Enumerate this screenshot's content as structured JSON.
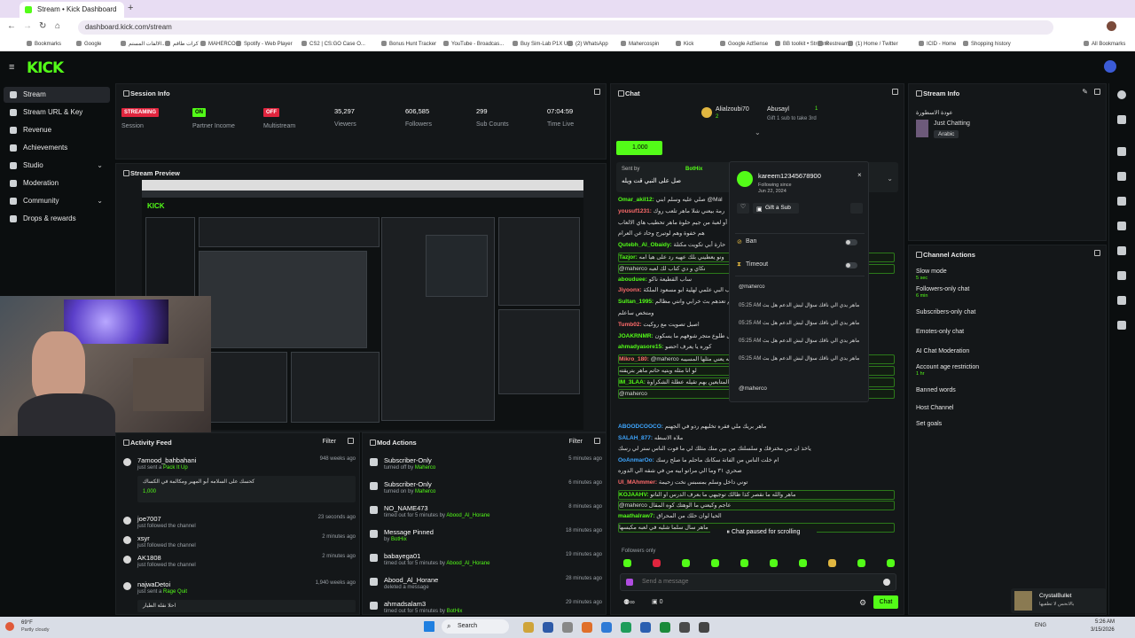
{
  "browser": {
    "tabs": [
      {
        "label": "Stream • Kick Dashboard"
      }
    ],
    "url": "dashboard.kick.com/stream",
    "bookmarks": [
      "Bookmarks",
      "Google",
      "الالفات المستم...",
      "كرات طاقم",
      "MAHERCO",
      "Spotify - Web Player",
      "CS2 | CS:GO Case O...",
      "Bonus Hunt Tracker",
      "YouTube - Broadcas...",
      "Buy Sim-Lab P1X Ul...",
      "(2) WhatsApp",
      "Mahercospin",
      "Kick",
      "Google AdSense",
      "BB toolkit • Streamr",
      "Restream",
      "(1) Home / Twitter",
      "ICID - Home",
      "Shopping history",
      "All Bookmarks"
    ]
  },
  "nav": {
    "items": [
      {
        "label": "Stream",
        "active": true
      },
      {
        "label": "Stream URL & Key"
      },
      {
        "label": "Revenue"
      },
      {
        "label": "Achievements"
      },
      {
        "label": "Studio",
        "chevron": true
      },
      {
        "label": "Moderation"
      },
      {
        "label": "Community",
        "chevron": true
      },
      {
        "label": "Drops & rewards"
      }
    ]
  },
  "session": {
    "title": "Session Info",
    "stats": [
      {
        "value": "STREAMING",
        "label": "Session",
        "badge": "red"
      },
      {
        "value": "ON",
        "label": "Partner Income",
        "badge": "green"
      },
      {
        "value": "OFF",
        "label": "Multistream",
        "badge": "red"
      },
      {
        "value": "35,297",
        "label": "Viewers"
      },
      {
        "value": "606,585",
        "label": "Followers"
      },
      {
        "value": "299",
        "label": "Sub Counts"
      },
      {
        "value": "07:04:59",
        "label": "Time Live"
      }
    ]
  },
  "preview": {
    "title": "Stream Preview"
  },
  "activity": {
    "title": "Activity Feed",
    "filter": "Filter",
    "items": [
      {
        "name": "7amood_bahbahani",
        "sub": "just sent a ",
        "extra": "Pack It Up",
        "time": "948 weeks ago",
        "note": "كحسك على السلامه أبو المهير ومكالمة في الكساك",
        "amount": "1,000"
      },
      {
        "name": "joe7007",
        "sub": "just followed the channel",
        "time": "23 seconds ago"
      },
      {
        "name": "xsyr",
        "sub": "just followed the channel",
        "time": "2 minutes ago"
      },
      {
        "name": "AK1808",
        "sub": "just followed the channel",
        "time": "2 minutes ago"
      },
      {
        "name": "najwaDetoi",
        "sub": "just sent a ",
        "extra": "Rage Quit",
        "time": "1,940 weeks ago",
        "note": "احلا نقلة الطيار"
      }
    ]
  },
  "mod": {
    "title": "Mod Actions",
    "filter": "Filter",
    "items": [
      {
        "name": "Subscriber-Only",
        "sub": "turned off by ",
        "who": "Maherco",
        "time": "5 minutes ago"
      },
      {
        "name": "Subscriber-Only",
        "sub": "turned on by ",
        "who": "Maherco",
        "time": "6 minutes ago"
      },
      {
        "name": "NO_NAME473",
        "sub": "timed out for 5 minutes by ",
        "who": "Abood_Al_Horane",
        "time": "8 minutes ago"
      },
      {
        "name": "Message Pinned",
        "sub": "by ",
        "who": "BotHix",
        "time": "18 minutes ago"
      },
      {
        "name": "babayega01",
        "sub": "timed out for 5 minutes by ",
        "who": "Abood_Al_Horane",
        "time": "19 minutes ago"
      },
      {
        "name": "Abood_Al_Horane",
        "sub": "deleted a message",
        "who": "",
        "time": "28 minutes ago"
      },
      {
        "name": "ahmadsalam3",
        "sub": "timed out for 5 minutes by ",
        "who": "BotHix",
        "time": "29 minutes ago"
      }
    ]
  },
  "chat": {
    "title": "Chat",
    "top": [
      {
        "name": "Alialzoubi70",
        "count": "2"
      },
      {
        "name": "Abusayl",
        "count": "1"
      }
    ],
    "gift_hint": "Gift 1 sub to take 3rd",
    "pill": "1,000",
    "pinned_by": "Sent by",
    "pinned_user": "BotHix",
    "pinned_text": "صل على النبي قت ويله",
    "lines": [
      {
        "user": "Omar_akil12:",
        "text": "صلي عليه وسلم ابني @Mal"
      },
      {
        "user": "yousuf1231:",
        "text": "رمة بيعني شلا ماهر تلعب روك",
        "c": "c3"
      },
      {
        "user": "",
        "text": "كتب أو لعبة من جيم حلوة ماهر تحطيب هاي الالعاب @Mahe"
      },
      {
        "user": "",
        "text": "هم خفوة وهم لوتيرج وحاد عن العرام"
      },
      {
        "user": "Qutebh_Al_Obaidy:",
        "text": "حارة أبي تكويت مكتلة"
      },
      {
        "user": "Tazjor:",
        "text": "ونو يعطيني بلك عهيه رد على هيا امه",
        "hl": true
      },
      {
        "user": "",
        "text": "@maherco نكاي و دي كتاب لك لعبه",
        "hl": true
      },
      {
        "user": "abouduee:",
        "text": "ساب القطيعة ناكو"
      },
      {
        "user": "Jiyoonx:",
        "text": "لعب البي علمي لهلية ابو مسعود الملكة",
        "c": "c3"
      },
      {
        "user": "Sultan_1995:",
        "text": "هو حرو زينهم تعدهم بث خرابي وانتي مظالم"
      },
      {
        "user": "",
        "text": "ومتخص ساعلم"
      },
      {
        "user": "Tumb02:",
        "text": "اصبل تصويت مع روكيت",
        "c": "c3"
      },
      {
        "user": "JOAKRNMR:",
        "text": "عمى طلوع متجر شوفهم ما يسكون"
      },
      {
        "user": "ahmadyasore15:",
        "text": "كوره يا يعرف احضو"
      },
      {
        "user": "Mikro_180:",
        "text": "@maherco نحن حته له يعني مثلها المسيبه",
        "c": "c3",
        "hl": true
      },
      {
        "user": "",
        "text": "لو انا مثله وبتيه حاتم ماهر بتريقته",
        "hl": true
      },
      {
        "user": "IM_3LAA:",
        "text": "المتابعين بهم تقيله عطلة الشكراوة",
        "hl": true
      },
      {
        "user": "",
        "text": "@maherco",
        "hl": true
      },
      {
        "user": "ABOODCOOCO:",
        "text": "ماهر بريك ملي فقره تخليهم ردو في الجهنم",
        "c": "c2"
      },
      {
        "user": "SALAH_877:",
        "text": "ملاه الاسطه",
        "c": "c2"
      },
      {
        "user": "",
        "text": "ياخذ ان من مخترقك و سلسلتك من بين منك مثلك لي ما فوت الناس ستر لي رسك"
      },
      {
        "user": "OoAnmarOo:",
        "text": "ام خلت الناس من الفاتة سكاتك ماحلم ما صلح رسك",
        "c": "c2"
      },
      {
        "user": "",
        "text": "صحري ٣١ وما الي مراتو ابيه من في شقه الي الدوره"
      },
      {
        "user": "Ul_MAhmmer:",
        "text": "توني داخل وسلم بمسبس نخت زحيمة",
        "c": "c3"
      },
      {
        "user": "KOJAAHV:",
        "text": "ماهر والله ما نقصر كذا ظالك توجيهي ما بعرف الدرس او الناتو",
        "hl": true
      },
      {
        "user": "",
        "text": "@maherco عاجم وكيعتي ما الوهتك كوه المقال",
        "hl": true
      },
      {
        "user": "maathalraw7:",
        "text": "الحيا لوان حلك من المحراق"
      },
      {
        "user": "",
        "text": "ماهر سال سلما شليه في لعبه مكيسها",
        "hl": true
      }
    ],
    "paused": "Chat paused for scrolling",
    "followers_only": "Followers only",
    "input_placeholder": "Send a message",
    "counter": "0",
    "send_label": "Chat"
  },
  "card": {
    "username": "kareem12345678900",
    "following_label": "Following since",
    "following_date": "Jun 22, 2024",
    "gift_label": "Gift a Sub",
    "ban_label": "Ban",
    "timeout_label": "Timeout",
    "msgs": [
      {
        "text": "@maherco"
      },
      {
        "time": "05:25 AM",
        "text": "ماهر يدي الي ناقك سؤال ليش الدعم هل بث"
      },
      {
        "time": "05:25 AM",
        "text": "ماهر يدي الي ناقك سؤال ليش الدعم هل بث"
      },
      {
        "time": "05:25 AM",
        "text": "ماهر يدي الي ناقك سؤال ليش الدعم هل بث"
      },
      {
        "time": "05:25 AM",
        "text": "ماهر يدي الي ناقك سؤال ليش الدعم هل بث"
      }
    ],
    "mention": "@maherco"
  },
  "stream_info": {
    "title": "Stream Info",
    "stream_title": "عودة الاسطورة",
    "category": "Just Chatting",
    "language": "Arabic"
  },
  "channel_actions": {
    "title": "Channel Actions",
    "items": [
      {
        "label": "Slow mode",
        "sub": "5 sec",
        "control": "arrow"
      },
      {
        "label": "Followers-only chat",
        "sub": "6 min",
        "control": "arrow"
      },
      {
        "label": "Subscribers-only chat",
        "control": "toggle"
      },
      {
        "label": "Emotes-only chat",
        "control": "toggle"
      },
      {
        "label": "AI Chat Moderation",
        "control": "link"
      },
      {
        "label": "Account age restriction",
        "sub": "1 hr",
        "control": "arrow"
      },
      {
        "label": "Banned words",
        "control": "arrow"
      },
      {
        "label": "Host Channel",
        "control": ""
      },
      {
        "label": "Set goals",
        "control": "arrow"
      }
    ]
  },
  "notification": {
    "name": "CrystalBullet",
    "sub": "بالانحس لا تطفيها"
  },
  "taskbar": {
    "weather": "69°F",
    "weather_sub": "Partly cloudy",
    "search": "Search",
    "lang": "ENG",
    "time": "5:26 AM",
    "date": "3/15/2026"
  },
  "colors": {
    "accent": "#53fc18",
    "danger": "#e0253e",
    "panel": "#141719",
    "bg": "#0b0e0f"
  }
}
